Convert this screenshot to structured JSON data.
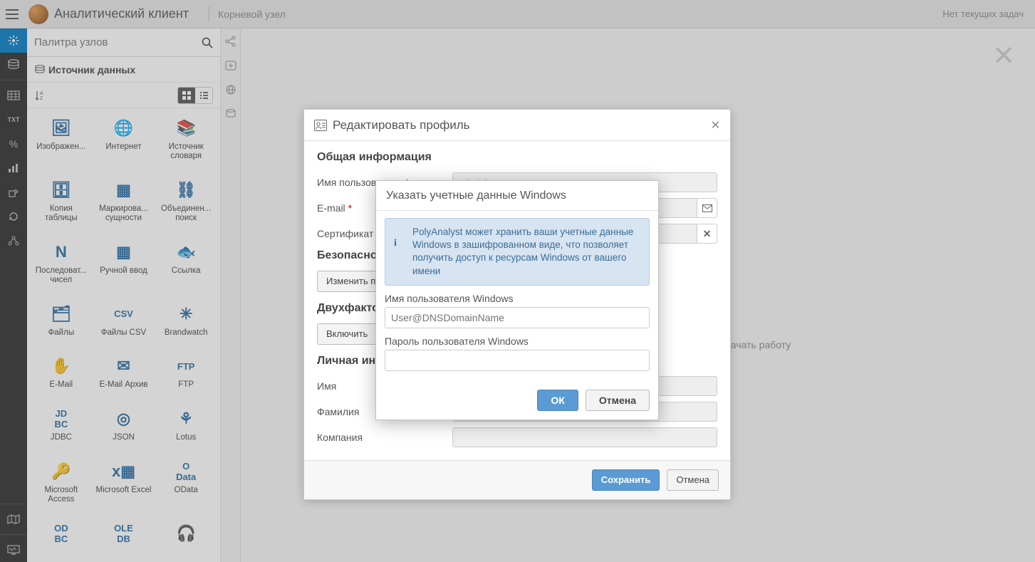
{
  "header": {
    "app_title": "Аналитический клиент",
    "breadcrumb": "Корневой узел",
    "status": "Нет текущих задач"
  },
  "sidebar": {
    "search_placeholder": "Палитра узлов",
    "section_title": "Источник данных"
  },
  "palette": [
    {
      "label": "Изображен...",
      "icon": "🖼"
    },
    {
      "label": "Интернет",
      "icon": "🌐"
    },
    {
      "label": "Источник словаря",
      "icon": "📚"
    },
    {
      "label": "Копия таблицы",
      "icon": "🗄"
    },
    {
      "label": "Маркирова... сущности",
      "icon": "▦"
    },
    {
      "label": "Объединен... поиск",
      "icon": "⛓"
    },
    {
      "label": "Последоват... чисел",
      "icon": "N"
    },
    {
      "label": "Ручной ввод",
      "icon": "▦"
    },
    {
      "label": "Ссылка",
      "icon": "🐟"
    },
    {
      "label": "Файлы",
      "icon": "🗂"
    },
    {
      "label": "Файлы CSV",
      "icon": "CSV"
    },
    {
      "label": "Brandwatch",
      "icon": "✳"
    },
    {
      "label": "E-Mail",
      "icon": "✋"
    },
    {
      "label": "E-Mail Архив",
      "icon": "✉"
    },
    {
      "label": "FTP",
      "icon": "FTP"
    },
    {
      "label": "JDBC",
      "icon": "JD BC"
    },
    {
      "label": "JSON",
      "icon": "◎"
    },
    {
      "label": "Lotus",
      "icon": "⚘"
    },
    {
      "label": "Microsoft Access",
      "icon": "🔑"
    },
    {
      "label": "Microsoft Excel",
      "icon": "x▦"
    },
    {
      "label": "OData",
      "icon": "O Data"
    },
    {
      "label": "",
      "icon": "OD BC"
    },
    {
      "label": "",
      "icon": "OLE DB"
    },
    {
      "label": "",
      "icon": "🎧"
    }
  ],
  "canvas": {
    "hint": "начать работу"
  },
  "edit_dialog": {
    "title": "Редактировать профиль",
    "section_general": "Общая информация",
    "label_username": "Имя пользователя",
    "value_username": "administrator",
    "label_email": "E-mail",
    "label_cert": "Сертификат",
    "section_security": "Безопаснос",
    "btn_change_password": "Изменить п",
    "section_2fa": "Двухфактор",
    "btn_enable": "Включить",
    "section_personal": "Личная инф",
    "label_firstname": "Имя",
    "label_lastname": "Фамилия",
    "label_company": "Компания",
    "btn_save": "Сохранить",
    "btn_cancel": "Отмена"
  },
  "win_dialog": {
    "title": "Указать учетные данные Windows",
    "info": "PolyAnalyst может хранить ваши учетные данные Windows в зашифрованном виде, что позволяет получить доступ к ресурсам Windows от вашего имени",
    "label_user": "Имя пользователя Windows",
    "placeholder_user": "User@DNSDomainName",
    "label_password": "Пароль пользователя Windows",
    "btn_ok": "ОК",
    "btn_cancel": "Отмена"
  }
}
